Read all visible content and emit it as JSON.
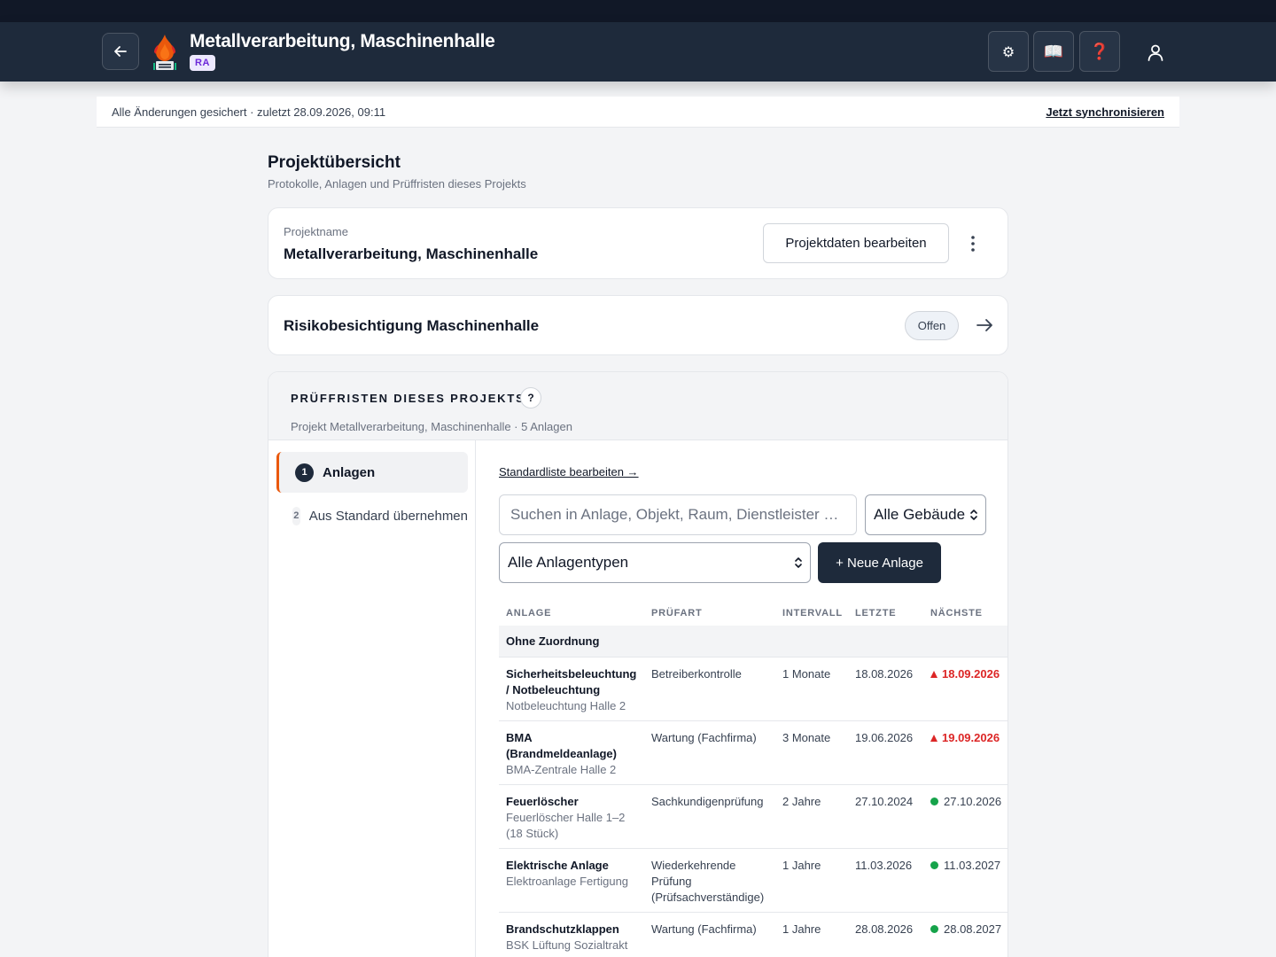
{
  "header": {
    "title": "Metallverarbeitung, Maschinenhalle",
    "badge": "RA",
    "icons": {
      "back": "back-arrow-icon",
      "logo": "flame-logo-icon",
      "settings": "gear-icon",
      "book": "book-icon",
      "help": "question-mark-icon",
      "user": "user-icon"
    },
    "settings_glyph": "⚙",
    "book_glyph": "📖",
    "help_glyph": "❓"
  },
  "syncbar": {
    "status": "Alle Änderungen gesichert · zuletzt 28.09.2026, 09:11",
    "action": "Jetzt synchronisieren"
  },
  "page": {
    "title": "Projektübersicht",
    "subtitle": "Protokolle, Anlagen und Prüffristen dieses Projekts"
  },
  "project_card": {
    "label": "Projektname",
    "name": "Metallverarbeitung, Maschinenhalle",
    "edit_label": "Projektdaten bearbeiten"
  },
  "risk_card": {
    "title": "Risikobesichtigung Maschinenhalle",
    "status": "Offen"
  },
  "deadlines": {
    "title": "PRÜFFRISTEN DIESES PROJEKTS",
    "help": "?",
    "subtitle": "Projekt Metallverarbeitung, Maschinenhalle · 5 Anlagen",
    "steps": [
      {
        "num": "1",
        "label": "Anlagen",
        "active": true
      },
      {
        "num": "2",
        "label": "Aus Standard übernehmen",
        "active": false
      }
    ],
    "std_link": "Standardliste bearbeiten →",
    "search_placeholder": "Suchen in Anlage, Objekt, Raum, Dienstleister …",
    "building_filter": "Alle Gebäude",
    "type_filter": "Alle Anlagentypen",
    "new_button": "+ Neue Anlage",
    "columns": [
      "ANLAGE",
      "PRÜFART",
      "INTERVALL",
      "LETZTE",
      "NÄCHSTE"
    ],
    "group": "Ohne Zuordnung",
    "rows": [
      {
        "name": "Sicherheitsbeleuchtung / Notbeleuchtung",
        "object": "Notbeleuchtung Halle 2",
        "type": "Betreiberkontrolle",
        "interval": "1 Monate",
        "last": "18.08.2026",
        "next": "18.09.2026",
        "status": "overdue"
      },
      {
        "name": "BMA (Brandmeldeanlage)",
        "object": "BMA-Zentrale Halle 2",
        "type": "Wartung (Fachfirma)",
        "interval": "3 Monate",
        "last": "19.06.2026",
        "next": "19.09.2026",
        "status": "overdue"
      },
      {
        "name": "Feuerlöscher",
        "object": "Feuerlöscher Halle 1–2 (18 Stück)",
        "type": "Sachkundigenprüfung",
        "interval": "2 Jahre",
        "last": "27.10.2024",
        "next": "27.10.2026",
        "status": "ok"
      },
      {
        "name": "Elektrische Anlage",
        "object": "Elektroanlage Fertigung",
        "type": "Wiederkehrende Prüfung (Prüfsachverständige)",
        "interval": "1 Jahre",
        "last": "11.03.2026",
        "next": "11.03.2027",
        "status": "ok"
      },
      {
        "name": "Brandschutzklappen",
        "object": "BSK Lüftung Sozialtrakt",
        "type": "Wartung (Fachfirma)",
        "interval": "1 Jahre",
        "last": "28.08.2026",
        "next": "28.08.2027",
        "status": "ok"
      }
    ]
  },
  "colors": {
    "header_bg": "#1e2a3b",
    "accent": "#ea580c",
    "overdue": "#dc2626",
    "ok": "#16a34a",
    "badge_bg": "#ede9fe",
    "badge_text": "#6d28d9"
  }
}
